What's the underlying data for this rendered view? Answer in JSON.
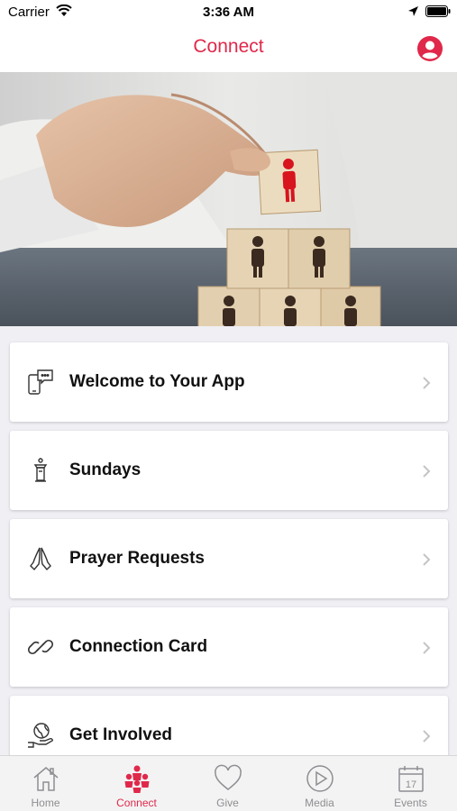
{
  "status_bar": {
    "carrier": "Carrier",
    "time": "3:36 AM"
  },
  "nav": {
    "title": "Connect",
    "profile_icon": "user-circle-icon"
  },
  "colors": {
    "accent": "#e0284a",
    "tab_inactive": "#8e8e93"
  },
  "menu": {
    "items": [
      {
        "label": "Welcome to Your App",
        "icon": "phone-chat-icon"
      },
      {
        "label": "Sundays",
        "icon": "pulpit-icon"
      },
      {
        "label": "Prayer Requests",
        "icon": "praying-hands-icon"
      },
      {
        "label": "Connection Card",
        "icon": "link-icon"
      },
      {
        "label": "Get Involved",
        "icon": "globe-hand-icon"
      }
    ]
  },
  "tabs": [
    {
      "label": "Home",
      "icon": "home-icon",
      "active": false
    },
    {
      "label": "Connect",
      "icon": "people-icon",
      "active": true
    },
    {
      "label": "Give",
      "icon": "heart-icon",
      "active": false
    },
    {
      "label": "Media",
      "icon": "play-circle-icon",
      "active": false
    },
    {
      "label": "Events",
      "icon": "calendar-icon",
      "active": false,
      "calendar_day": "17"
    }
  ]
}
